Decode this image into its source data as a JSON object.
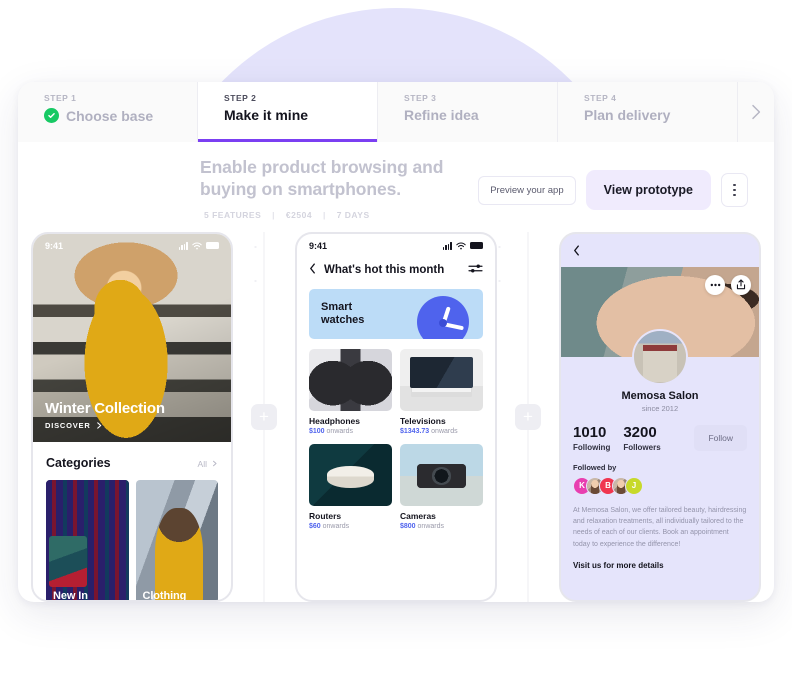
{
  "steps": [
    {
      "num": "STEP 1",
      "label": "Choose base",
      "state": "complete"
    },
    {
      "num": "STEP 2",
      "label": "Make it mine",
      "state": "active"
    },
    {
      "num": "STEP 3",
      "label": "Refine idea",
      "state": "upcoming"
    },
    {
      "num": "STEP 4",
      "label": "Plan delivery",
      "state": "upcoming"
    }
  ],
  "steps_next_icon": "chevron-right-icon",
  "header": {
    "title": "Enable product browsing and buying on smartphones.",
    "meta_features": "5 FEATURES",
    "meta_price": "€2504",
    "meta_duration": "7 DAYS",
    "separator": "|",
    "preview_label": "Preview your app",
    "prototype_label": "View prototype",
    "kebab_icon": "more-vertical-icon"
  },
  "add_button_label": "+",
  "phone1": {
    "status_time": "9:41",
    "hero_title": "Winter Collection",
    "hero_cta": "DISCOVER",
    "hero_cta_icon": "chevron-right-icon",
    "section_title": "Categories",
    "section_all": "All",
    "section_all_icon": "chevron-right-icon",
    "categories": [
      {
        "label": "New In"
      },
      {
        "label": "Clothing"
      }
    ]
  },
  "phone2": {
    "status_time": "9:41",
    "back_icon": "chevron-left-icon",
    "nav_title": "What's hot this month",
    "filter_icon": "sliders-icon",
    "banner_line1": "Smart",
    "banner_line2": "watches",
    "banner_icon": "clock-icon",
    "products": [
      {
        "name": "Headphones",
        "price": "$100",
        "suffix": "onwards"
      },
      {
        "name": "Televisions",
        "price": "$1343.73",
        "suffix": "onwards"
      },
      {
        "name": "Routers",
        "price": "$60",
        "suffix": "onwards"
      },
      {
        "name": "Cameras",
        "price": "$800",
        "suffix": "onwards"
      }
    ]
  },
  "phone3": {
    "back_icon": "chevron-left-icon",
    "more_icon": "more-horizontal-icon",
    "share_icon": "share-icon",
    "name": "Memosa Salon",
    "since": "since 2012",
    "stats": [
      {
        "value": "1010",
        "label": "Following"
      },
      {
        "value": "3200",
        "label": "Followers"
      }
    ],
    "follow_label": "Follow",
    "followed_by_label": "Followed by",
    "followers_avatars": [
      {
        "initial": "K",
        "color": "#e83fb0",
        "kind": "initial"
      },
      {
        "initial": "",
        "color": "#c8b2a0",
        "kind": "photo"
      },
      {
        "initial": "B",
        "color": "#f0354f",
        "kind": "initial"
      },
      {
        "initial": "",
        "color": "#a98d76",
        "kind": "photo"
      },
      {
        "initial": "J",
        "color": "#c7d92a",
        "kind": "initial"
      }
    ],
    "description": "At Memosa Salon, we offer tailored beauty, hairdressing and relaxation treatments, all individually tailored to the needs of each of our clients. Book an appointment today to experience the difference!",
    "link": "Visit us for more details"
  },
  "colors": {
    "accent_purple": "#7b3ff2",
    "primary_button_bg": "#f0ebfd",
    "complete_green": "#17c964",
    "background_circle": "#e4e3fb",
    "banner_blue": "#bcdcf7",
    "clock_indigo": "#4f63ed",
    "price_blue": "#4f63ed"
  }
}
